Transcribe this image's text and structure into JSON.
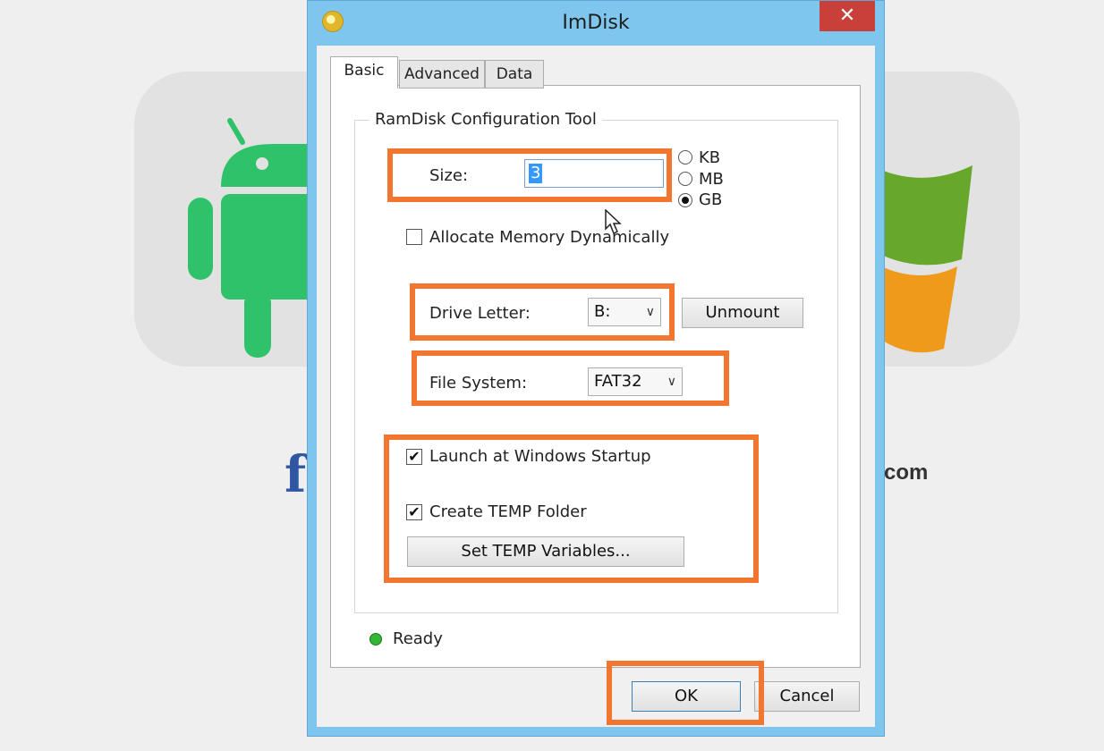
{
  "window": {
    "title": "ImDisk",
    "close_glyph": "✕"
  },
  "tabs": [
    {
      "label": "Basic",
      "active": true
    },
    {
      "label": "Advanced",
      "active": false
    },
    {
      "label": "Data",
      "active": false
    }
  ],
  "group_title": "RamDisk Configuration Tool",
  "size": {
    "label": "Size:",
    "value": "3",
    "units": [
      {
        "label": "KB",
        "selected": false
      },
      {
        "label": "MB",
        "selected": false
      },
      {
        "label": "GB",
        "selected": true
      }
    ]
  },
  "allocate_dynamic": {
    "label": "Allocate Memory Dynamically",
    "checked": false
  },
  "drive_letter": {
    "label": "Drive Letter:",
    "value": "B:",
    "unmount_label": "Unmount"
  },
  "file_system": {
    "label": "File System:",
    "value": "FAT32"
  },
  "launch_startup": {
    "label": "Launch at Windows Startup",
    "checked": true,
    "mark": "✔"
  },
  "create_temp": {
    "label": "Create TEMP Folder",
    "checked": true,
    "mark": "✔"
  },
  "set_temp_label": "Set TEMP Variables...",
  "status": {
    "text": "Ready",
    "color": "#35b535"
  },
  "buttons": {
    "ok": "OK",
    "cancel": "Cancel"
  },
  "combo_arrow": "∨",
  "background": {
    "left_mark": "f",
    "right_text": "com"
  },
  "colors": {
    "highlight": "#f27630",
    "window_frame": "#7ec6ee",
    "close": "#c9403a"
  }
}
